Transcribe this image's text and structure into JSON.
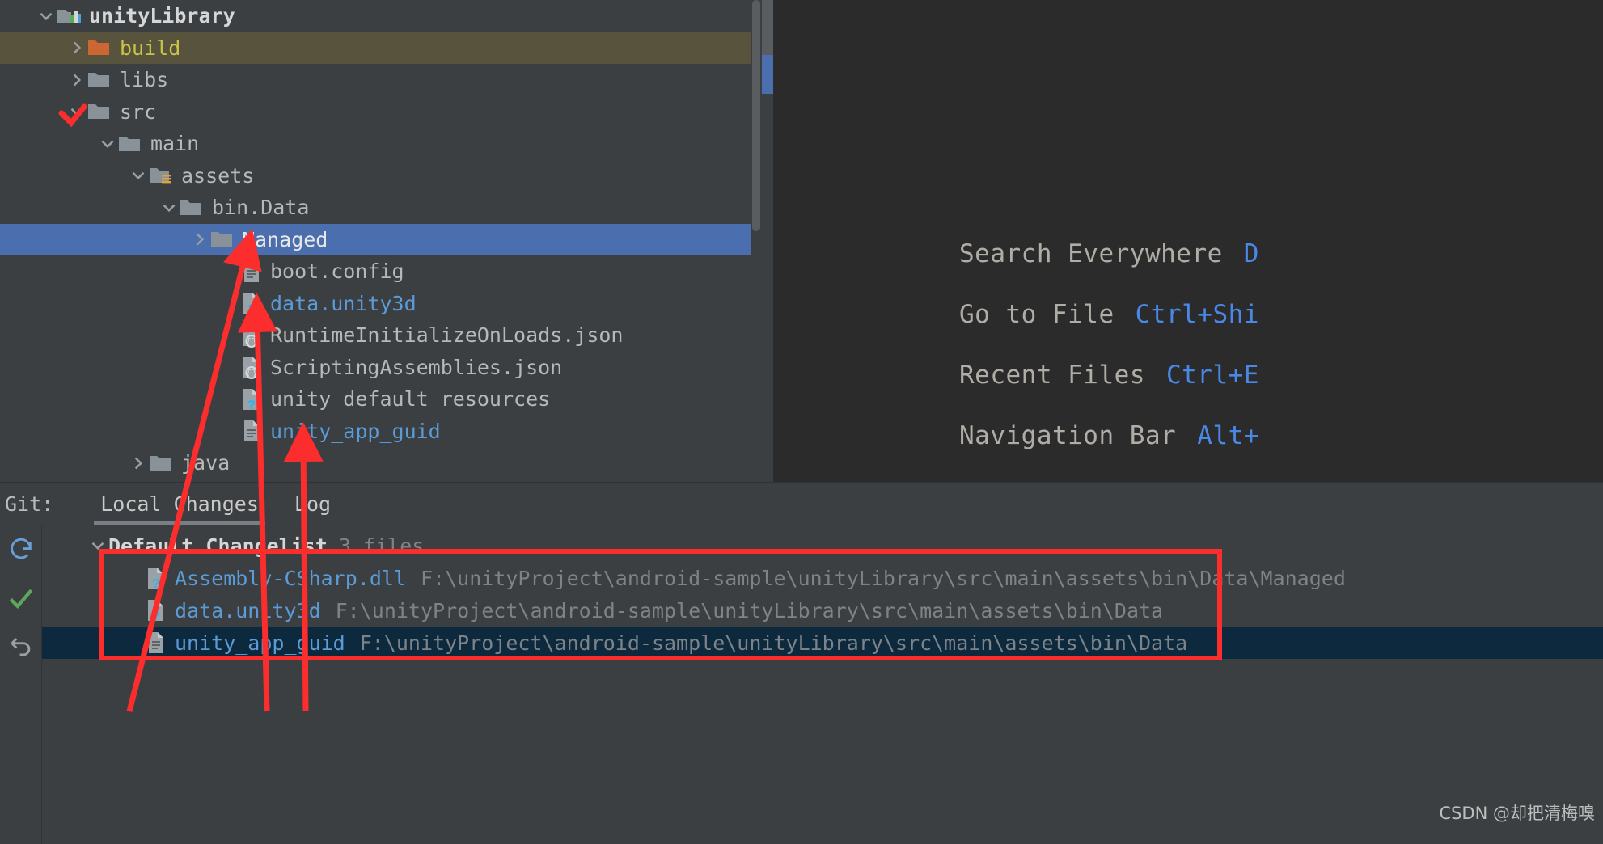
{
  "colors": {
    "bg_tree": "#3c3f41",
    "bg_editor": "#2b2b2b",
    "selection_blue": "#4b6eaf",
    "hover_olive": "#57533d",
    "link_blue": "#5a9bd8",
    "key_blue": "#4a88e8",
    "annotation_red": "#fc2d2d",
    "folder_grey": "#8a9299",
    "folder_orange": "#cd6632",
    "selected_row_dark": "#0d293e"
  },
  "tree": {
    "rows": [
      {
        "label": "unityLibrary",
        "indent": 0,
        "twisty": "expanded",
        "icon": "module-icon",
        "style": "bold",
        "state": "normal"
      },
      {
        "label": "build",
        "indent": 1,
        "twisty": "collapsed",
        "icon": "folder-orange-icon",
        "style": "yellow",
        "state": "hover"
      },
      {
        "label": "libs",
        "indent": 1,
        "twisty": "collapsed",
        "icon": "folder-icon",
        "style": "grey",
        "state": "normal"
      },
      {
        "label": "src",
        "indent": 1,
        "twisty": "expanded",
        "icon": "folder-icon",
        "style": "grey",
        "state": "normal"
      },
      {
        "label": "main",
        "indent": 2,
        "twisty": "expanded",
        "icon": "folder-icon",
        "style": "grey",
        "state": "normal"
      },
      {
        "label": "assets",
        "indent": 3,
        "twisty": "expanded",
        "icon": "folder-assets-icon",
        "style": "grey",
        "state": "normal"
      },
      {
        "label": "bin.Data",
        "indent": 4,
        "twisty": "expanded",
        "icon": "folder-icon",
        "style": "grey",
        "state": "normal"
      },
      {
        "label": "Managed",
        "indent": 5,
        "twisty": "collapsed",
        "icon": "folder-icon",
        "style": "selected",
        "state": "selected"
      },
      {
        "label": "boot.config",
        "indent": 6,
        "twisty": "none",
        "icon": "file-text-icon",
        "style": "grey",
        "state": "normal"
      },
      {
        "label": "data.unity3d",
        "indent": 6,
        "twisty": "none",
        "icon": "file-unknown-icon",
        "style": "blue",
        "state": "normal"
      },
      {
        "label": "RuntimeInitializeOnLoads.json",
        "indent": 6,
        "twisty": "none",
        "icon": "file-json-icon",
        "style": "grey",
        "state": "normal"
      },
      {
        "label": "ScriptingAssemblies.json",
        "indent": 6,
        "twisty": "none",
        "icon": "file-json-icon",
        "style": "grey",
        "state": "normal"
      },
      {
        "label": "unity default resources",
        "indent": 6,
        "twisty": "none",
        "icon": "file-unknown-icon",
        "style": "grey",
        "state": "normal"
      },
      {
        "label": "unity_app_guid",
        "indent": 6,
        "twisty": "none",
        "icon": "file-text-icon",
        "style": "blue",
        "state": "normal"
      },
      {
        "label": "java",
        "indent": 3,
        "twisty": "collapsed",
        "icon": "folder-icon",
        "style": "grey",
        "state": "normal"
      }
    ]
  },
  "editor_tips": {
    "items": [
      {
        "action": "Search Everywhere",
        "key": "D"
      },
      {
        "action": "Go to File",
        "key": "Ctrl+Shi"
      },
      {
        "action": "Recent Files",
        "key": "Ctrl+E"
      },
      {
        "action": "Navigation Bar",
        "key": "Alt+"
      }
    ]
  },
  "git_panel": {
    "title": "Git:",
    "tabs": [
      {
        "label": "Local Changes",
        "active": true
      },
      {
        "label": "Log",
        "active": false
      }
    ],
    "side_buttons": [
      {
        "name": "refresh-icon"
      },
      {
        "name": "checkmark-icon"
      },
      {
        "name": "rollback-icon"
      }
    ],
    "changelist": {
      "title": "Default Changelist",
      "count": "3 files",
      "rows": [
        {
          "name": "Assembly-CSharp.dll",
          "path": "F:\\unityProject\\android-sample\\unityLibrary\\src\\main\\assets\\bin\\Data\\Managed",
          "icon": "file-unknown-icon",
          "name_color": "blue",
          "selected": false
        },
        {
          "name": "data.unity3d",
          "path": "F:\\unityProject\\android-sample\\unityLibrary\\src\\main\\assets\\bin\\Data",
          "icon": "file-unknown-icon",
          "name_color": "blue",
          "selected": false
        },
        {
          "name": "unity_app_guid",
          "path": "F:\\unityProject\\android-sample\\unityLibrary\\src\\main\\assets\\bin\\Data",
          "icon": "file-text-icon",
          "name_color": "blue",
          "selected": true
        }
      ]
    }
  },
  "watermark": {
    "text": "CSDN @却把清梅嗅"
  }
}
